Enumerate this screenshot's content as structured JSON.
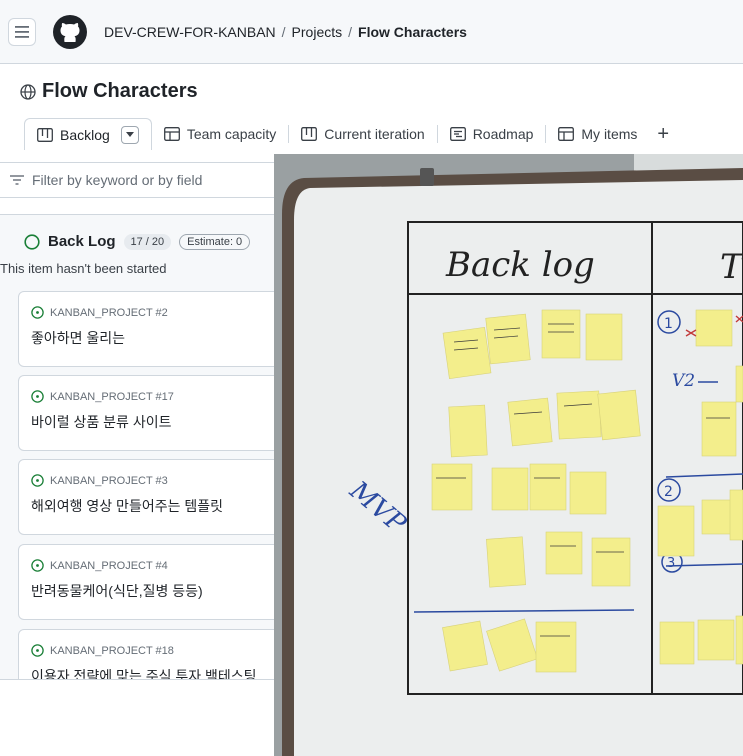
{
  "header": {
    "org": "DEV-CREW-FOR-KANBAN",
    "separator": "/",
    "projects_link": "Projects",
    "current": "Flow Characters"
  },
  "project": {
    "title": "Flow Characters"
  },
  "tabs": [
    {
      "label": "Backlog",
      "icon": "board-icon",
      "active": true
    },
    {
      "label": "Team capacity",
      "icon": "table-icon"
    },
    {
      "label": "Current iteration",
      "icon": "board-icon"
    },
    {
      "label": "Roadmap",
      "icon": "roadmap-icon"
    },
    {
      "label": "My items",
      "icon": "table-icon"
    }
  ],
  "add_view": "+",
  "filter": {
    "placeholder": "Filter by keyword or by field"
  },
  "column": {
    "title": "Back Log",
    "count": "17 / 20",
    "estimate": "Estimate: 0",
    "description": "This item hasn't been started",
    "cards": [
      {
        "ref": "KANBAN_PROJECT #2",
        "title": "좋아하면 울리는"
      },
      {
        "ref": "KANBAN_PROJECT #17",
        "title": "바이럴 상품 분류 사이트"
      },
      {
        "ref": "KANBAN_PROJECT #3",
        "title": "해외여행 영상 만들어주는 템플릿"
      },
      {
        "ref": "KANBAN_PROJECT #4",
        "title": "반려동물케어(식단,질병 등등)"
      },
      {
        "ref": "KANBAN_PROJECT #18",
        "title": "이용자 전략에 맞는 주식 투자 백테스팅"
      }
    ]
  },
  "photo": {
    "heading_left": "Back log",
    "heading_right": "T",
    "side_label": "MVP",
    "marks": [
      "1",
      "2",
      "3",
      "V2"
    ]
  },
  "colors": {
    "border": "#d0d7de",
    "muted": "#656d76",
    "open_status": "#1a7f37",
    "sticky_note": "#f3ee8c"
  }
}
